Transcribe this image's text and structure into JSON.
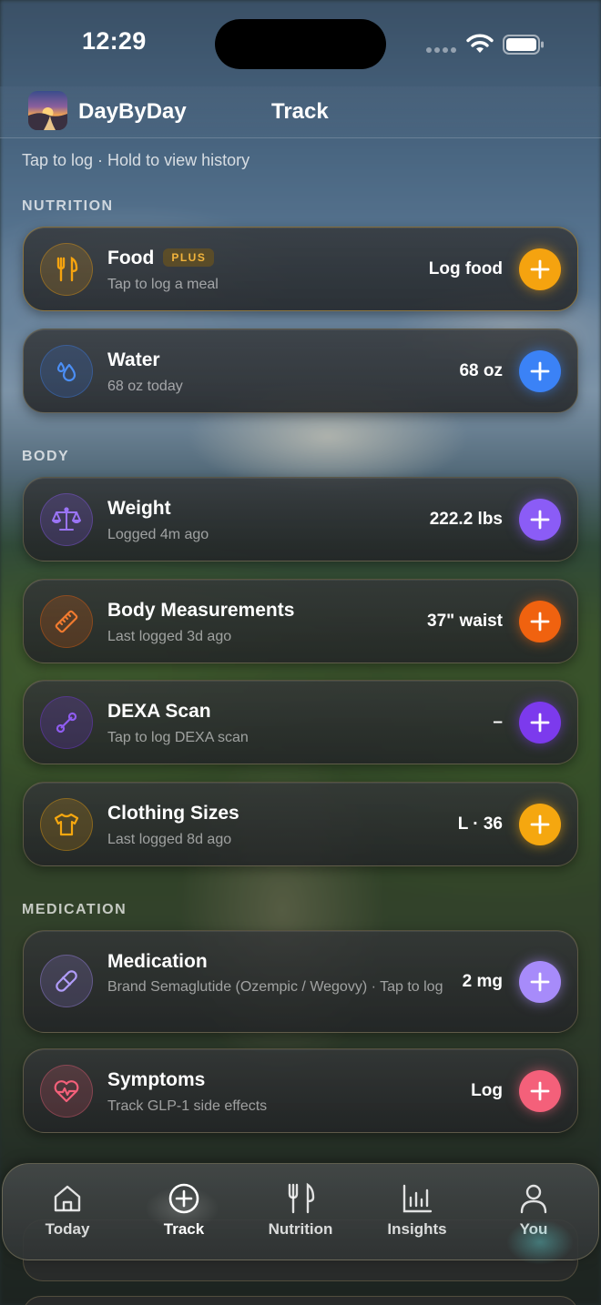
{
  "status_bar": {
    "time": "12:29"
  },
  "header": {
    "app_name": "DayByDay",
    "title": "Track"
  },
  "hint": "Tap to log · Hold to view history",
  "sections": {
    "nutrition": "NUTRITION",
    "body": "BODY",
    "medication": "MEDICATION"
  },
  "cards": {
    "food": {
      "title": "Food",
      "badge": "PLUS",
      "subtitle": "Tap to log a meal",
      "value": "Log food",
      "icon": "fork-knife-icon",
      "color": "#f5a30f"
    },
    "water": {
      "title": "Water",
      "subtitle": "68 oz today",
      "value": "68 oz",
      "icon": "water-drops-icon",
      "color": "#3b82f6"
    },
    "weight": {
      "title": "Weight",
      "subtitle": "Logged 4m ago",
      "value": "222.2 lbs",
      "icon": "scale-icon",
      "color": "#8b5cf6"
    },
    "measurements": {
      "title": "Body Measurements",
      "subtitle": "Last logged 3d ago",
      "value": "37\" waist",
      "icon": "ruler-icon",
      "color": "#f0620f"
    },
    "dexa": {
      "title": "DEXA Scan",
      "subtitle": "Tap to log DEXA scan",
      "value": "–",
      "icon": "bone-icon",
      "color": "#7c3aed"
    },
    "clothing": {
      "title": "Clothing Sizes",
      "subtitle": "Last logged 8d ago",
      "value": "L · 36",
      "icon": "shirt-icon",
      "color": "#f5a70f"
    },
    "medication": {
      "title": "Medication",
      "subtitle": "Brand Semaglutide (Ozempic / Wegovy) · Tap to log",
      "value": "2 mg",
      "icon": "pill-icon",
      "color": "#a78bfa"
    },
    "symptoms": {
      "title": "Symptoms",
      "subtitle": "Track GLP-1 side effects",
      "value": "Log",
      "icon": "heart-pulse-icon",
      "color": "#f4607a"
    }
  },
  "tabs": [
    {
      "label": "Today",
      "icon": "home-icon"
    },
    {
      "label": "Track",
      "icon": "plus-circle-icon"
    },
    {
      "label": "Nutrition",
      "icon": "fork-knife-icon"
    },
    {
      "label": "Insights",
      "icon": "bar-chart-icon"
    },
    {
      "label": "You",
      "icon": "person-icon"
    }
  ]
}
